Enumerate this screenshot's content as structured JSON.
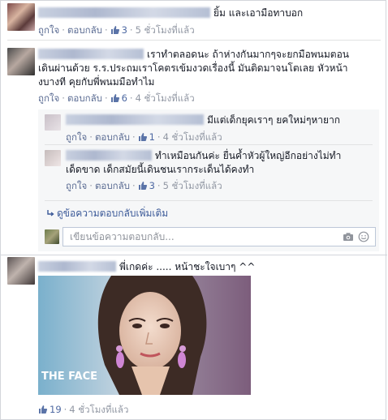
{
  "comments": [
    {
      "text": "ยิ้ม และเอามือทาบอก",
      "like": "ถูกใจ",
      "reply": "ตอบกลับ",
      "likes": "3",
      "time": "5 ชั่วโมงที่แล้ว"
    },
    {
      "text": "เราทำตลอดนะ ถ้าห่างกันมากๆจะยกมือพนมตอนเดินผ่านด้วย ร.ร.ประถมเราโคตรเข้มงวดเรื่องนี้ มันติดมาจนโตเลย หัวหน้างบางที คุยกับพี่พนมมือทำไม",
      "line1": "เราทำตลอดนะ ถ้าห่างกันมากๆจะยกมือพนมตอน",
      "line2": "เดินผ่านด้วย ร.ร.ประถมเราโคตรเข้มงวดเรื่องนี้ มันติดมาจนโตเลย หัวหน้า",
      "line3": "งบางที คุยกับพี่พนมมือทำไม",
      "like": "ถูกใจ",
      "reply": "ตอบกลับ",
      "likes": "6",
      "time": "4 ชั่วโมงที่แล้ว",
      "replies": [
        {
          "text": "มีแต่เด็กยุคเราๆ ยคใหม่ๆหายาก",
          "like": "ถูกใจ",
          "reply": "ตอบกลับ",
          "likes": "1",
          "time": "4 ชั่วโมงที่แล้ว"
        },
        {
          "line1": "ทำเหมือนกันค่ะ ยื่นค้ำหัวผู้ใหญ่อีกอย่างไม่ทำ",
          "line2": "เด็ดขาด เด็กสมัยนี้เดินชนเรากระเด็นได้คงทำ",
          "like": "ถูกใจ",
          "reply": "ตอบกลับ",
          "likes": "3",
          "time": "5 ชั่วโมงที่แล้ว"
        }
      ],
      "more_replies": "ดูข้อความตอบกลับเพิ่มเติม",
      "reply_placeholder": "เขียนข้อความตอบกลับ..."
    },
    {
      "text": "พี่เกดค่ะ ..... หน้าชะใจเบาๆ ^^",
      "image_logo": "THE FACE",
      "likes": "19",
      "time": "4 ชั่วโมงที่แล้ว"
    }
  ],
  "colors": {
    "link": "#3b5998",
    "meta": "#9197a3",
    "reply_bg": "#f6f7f8"
  },
  "icons": [
    "thumbs-up-icon",
    "camera-icon",
    "emoji-icon",
    "reply-arrow-icon"
  ]
}
